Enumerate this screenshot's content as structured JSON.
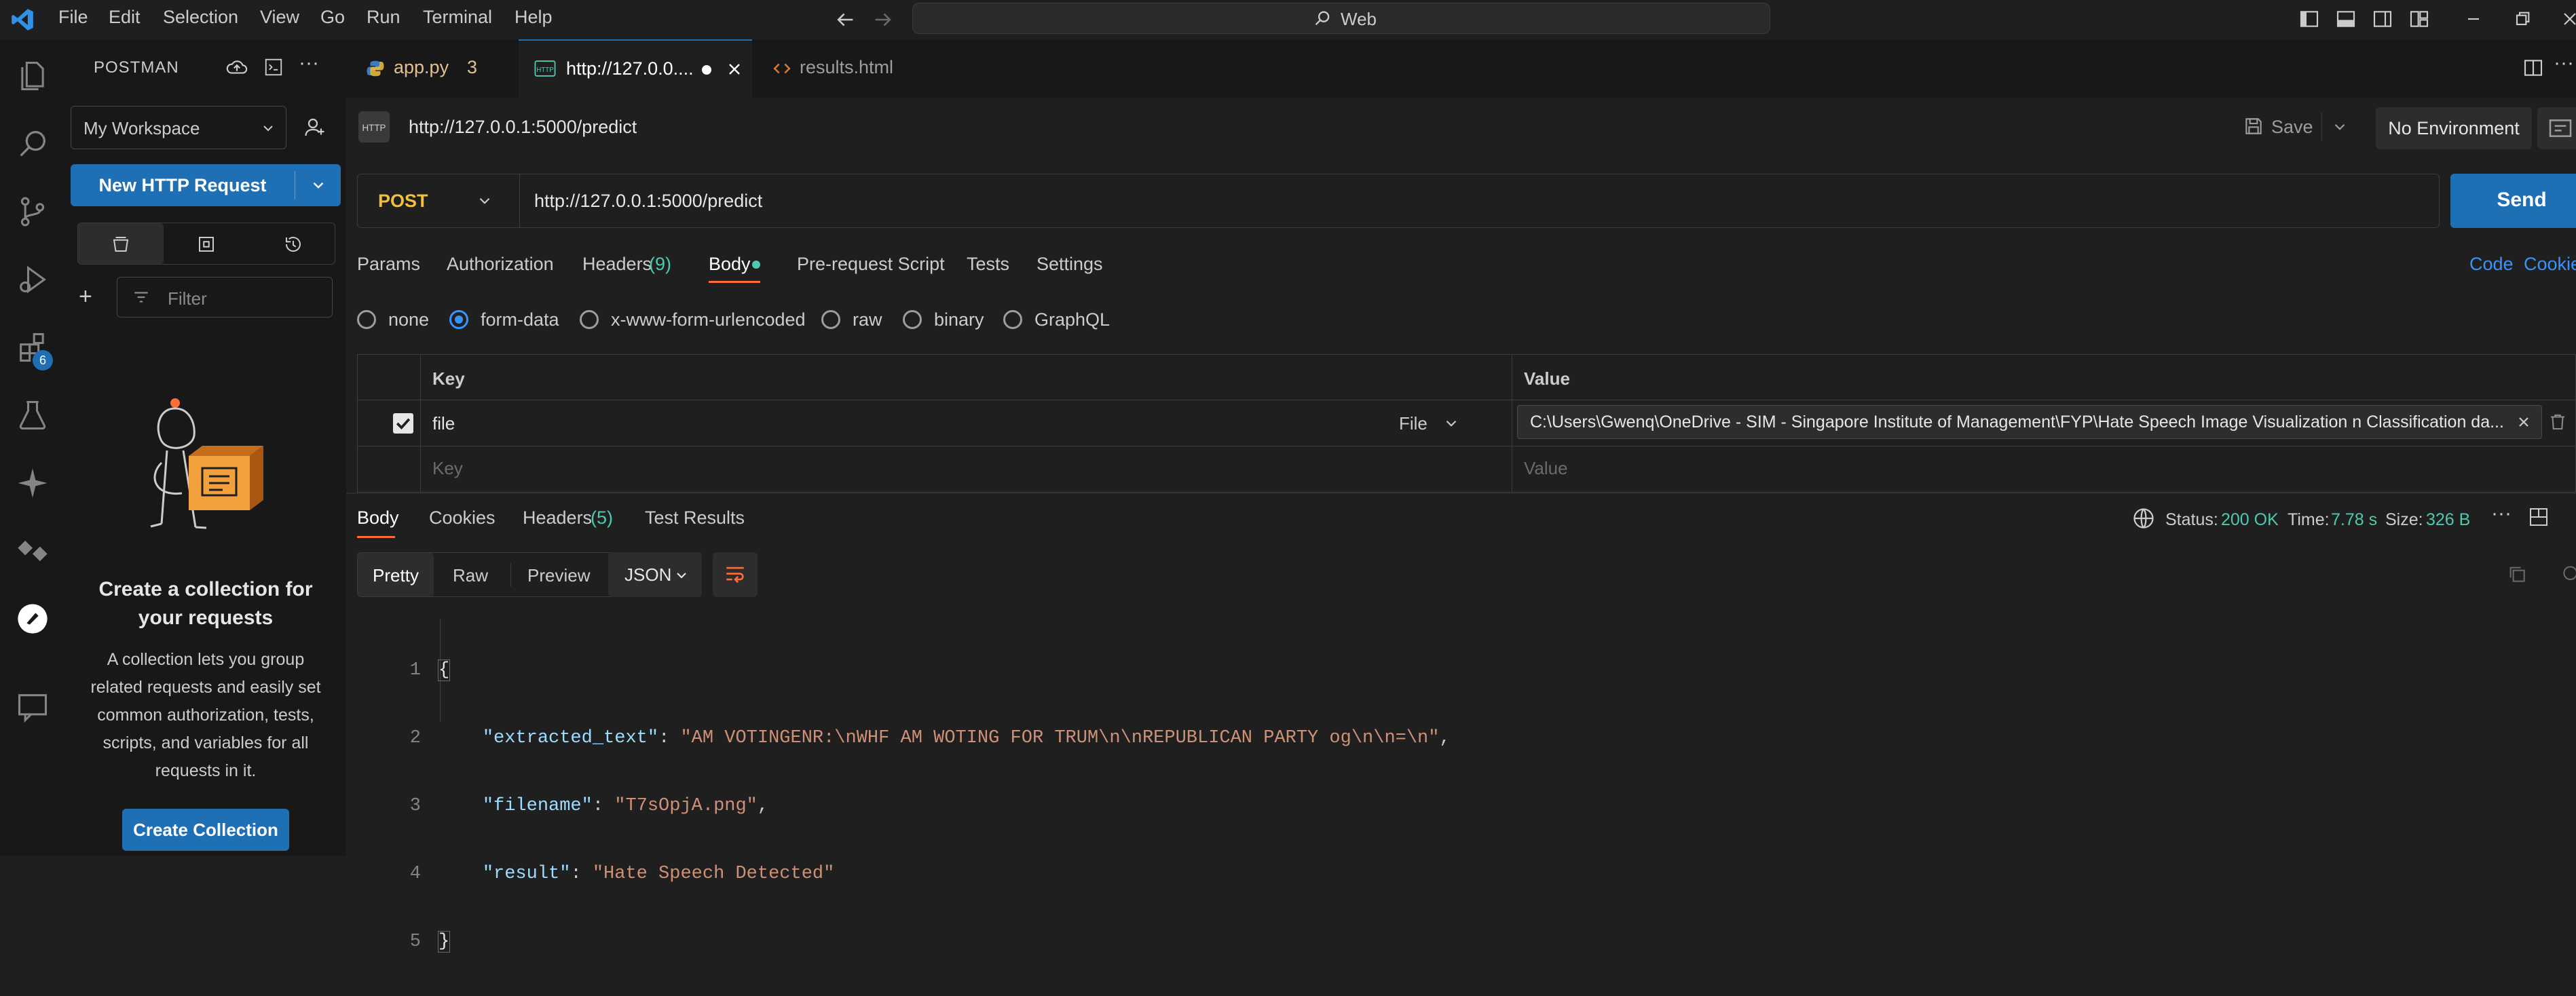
{
  "menu": [
    "File",
    "Edit",
    "Selection",
    "View",
    "Go",
    "Run",
    "Terminal",
    "Help"
  ],
  "command_center": {
    "text": "Web"
  },
  "activity_badge": "6",
  "sidebar": {
    "title": "POSTMAN",
    "workspace": "My Workspace",
    "new_request": "New HTTP Request",
    "filter_placeholder": "Filter",
    "empty_title": "Create a collection for your requests",
    "empty_desc": "A collection lets you group related requests and easily set common authorization, tests, scripts, and variables for all requests in it.",
    "create_button": "Create Collection"
  },
  "tabs": [
    {
      "label": "app.py",
      "badge": "3"
    },
    {
      "label": "http://127.0.0....",
      "active": true
    },
    {
      "label": "results.html"
    }
  ],
  "request": {
    "title": "http://127.0.0.1:5000/predict",
    "save": "Save",
    "environment": "No Environment",
    "method": "POST",
    "url": "http://127.0.0.1:5000/predict",
    "send": "Send",
    "req_tabs": [
      "Params",
      "Authorization",
      "Headers",
      "Body",
      "Pre-request Script",
      "Tests",
      "Settings"
    ],
    "headers_count": "(9)",
    "code_link": "Code",
    "cookies_link": "Cookies",
    "body_types": [
      "none",
      "form-data",
      "x-www-form-urlencoded",
      "raw",
      "binary",
      "GraphQL"
    ],
    "body_selected": "form-data",
    "table": {
      "key_header": "Key",
      "value_header": "Value",
      "row_key": "file",
      "row_type": "File",
      "row_value": "C:\\Users\\Gwenq\\OneDrive - SIM - Singapore Institute of Management\\FYP\\Hate Speech Image Visualization n Classification da...",
      "key_placeholder": "Key",
      "value_placeholder": "Value"
    }
  },
  "response": {
    "tabs": [
      "Body",
      "Cookies",
      "Headers",
      "Test Results"
    ],
    "headers_count": "(5)",
    "status_label": "Status:",
    "status": "200 OK",
    "time_label": "Time:",
    "time": "7.78 s",
    "size_label": "Size:",
    "size": "326 B",
    "view_modes": [
      "Pretty",
      "Raw",
      "Preview"
    ],
    "format": "JSON",
    "line_numbers": [
      "1",
      "2",
      "3",
      "4",
      "5"
    ],
    "json": {
      "open": "{",
      "close": "}",
      "k1": "\"extracted_text\"",
      "v1": "\"AM VOTINGENR:\\nWHF AM WOTING FOR TRUM\\n\\nREPUBLICAN PARTY og\\n\\n=\\n\"",
      "k2": "\"filename\"",
      "v2": "\"T7sOpjA.png\"",
      "k3": "\"result\"",
      "v3": "\"Hate Speech Detected\""
    }
  },
  "colors": {
    "accent_blue": "#1f6fb5",
    "status_green": "#4ec9b0",
    "method_orange": "#f2c03d",
    "json_key": "#9cdcfe",
    "json_string": "#ce9178"
  }
}
